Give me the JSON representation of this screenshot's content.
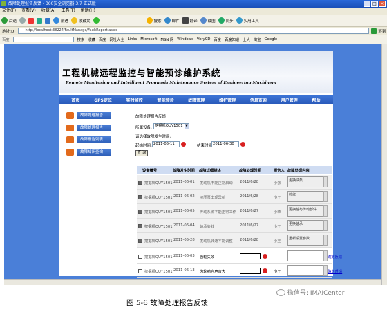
{
  "window": {
    "title": "故障处理报告反馈 - 360安全浏览器 3.7 正式版"
  },
  "menu": [
    "文件(F)",
    "查看(V)",
    "收藏(A)",
    "工具(T)",
    "帮助(H)"
  ],
  "toolbar": {
    "back": "后退",
    "forward": "前进",
    "fav": "收藏夹",
    "search": "搜索",
    "mail": "邮件",
    "translate": "翻译",
    "screenshot": "截图",
    "sync": "同步",
    "app": "实用工具"
  },
  "address": {
    "label": "地址(D)",
    "url": "http://localhost:38224/FaultManage/FaultReport.aspx",
    "go": "转到"
  },
  "favbar": {
    "search_label": "百度",
    "items": [
      "搜索",
      "收藏",
      "百度",
      "网址大全",
      "Links",
      "Microsoft",
      "MSN 网",
      "Windows",
      "VeryCD",
      "百度",
      "百度知道",
      "上大",
      "淘宝",
      "Google"
    ]
  },
  "banner": {
    "title": "工程机械远程监控与智能预诊维护系统",
    "subtitle": "Remote Monitoring and Intelligent Prognosis Maintenance System of Engineering Machinery"
  },
  "nav": [
    "首页",
    "GPS定位",
    "实时监控",
    "智能预诊",
    "故障管理",
    "维护管理",
    "信息查询",
    "用户管理",
    "帮助"
  ],
  "sidebar": [
    "故障处理报告",
    "故障处理报告",
    "故障报告列表",
    "故障知识查询"
  ],
  "form": {
    "heading": "故障处理报告反馈",
    "device_label": "所属设备:",
    "device_value": "挖掘机QUY1501",
    "time_label": "请选择故障发生时间:",
    "start_label": "起始时间:",
    "start_value": "2011-05-11",
    "end_label": "结束时间:",
    "end_value": "2011-06-30",
    "query_button": "查 询"
  },
  "table": {
    "headers": [
      "设备编号",
      "故障发生时间",
      "故障详细描述",
      "故障处理时间",
      "报告人",
      "故障处理内容"
    ],
    "rows": [
      {
        "check": true,
        "device": "挖掘机QUY1501",
        "date": "2011-06-01",
        "desc": "发动机不能正常启动",
        "handled": "2011/6/28",
        "reporter": "小张",
        "content": "更换油泵"
      },
      {
        "check": true,
        "device": "挖掘机QUY1501",
        "date": "2011-06-02",
        "desc": "液压泵出现异响",
        "handled": "2011/6/28",
        "reporter": "小王",
        "content": "检修"
      },
      {
        "check": true,
        "device": "挖掘机QUY1501",
        "date": "2011-06-05",
        "desc": "传动系统不能正常工作",
        "handled": "2011/6/27",
        "reporter": "小李",
        "content": "更换轴与传动部件"
      },
      {
        "check": true,
        "device": "挖掘机QUY1501",
        "date": "2011-06-04",
        "desc": "轴承失效",
        "handled": "2011/6/27",
        "reporter": "小王",
        "content": "更换轴承"
      },
      {
        "check": true,
        "device": "挖掘机QUY1501",
        "date": "2011-05-28",
        "desc": "发动机转速不能调整",
        "handled": "2011/6/28",
        "reporter": "小王",
        "content": "重新设置参数"
      },
      {
        "check": false,
        "device": "挖掘机QUY1501",
        "date": "2011-06-03",
        "desc": "齿轮失效",
        "handled": "",
        "reporter": "",
        "content": "",
        "confirm": "确定反馈"
      },
      {
        "check": false,
        "device": "挖掘机QUY1501",
        "date": "2011-06-13",
        "desc": "齿轮啮合声音大",
        "handled": "",
        "reporter": "小王",
        "content": "",
        "confirm": "确定反馈"
      }
    ]
  },
  "caption": "图 5-6  故障处理报告反馈",
  "watermark": "微信号: IMAICenter"
}
